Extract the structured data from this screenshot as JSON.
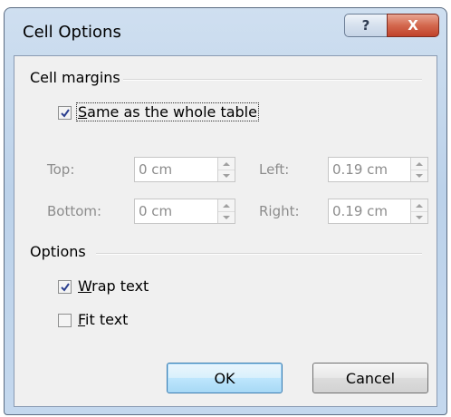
{
  "window": {
    "title": "Cell Options",
    "help_glyph": "?",
    "close_glyph": "X"
  },
  "cell_margins": {
    "group_label": "Cell margins",
    "same_as_table": {
      "label": "Same as the whole table",
      "mnemonic": "S",
      "rest": "ame as the whole table",
      "checked": true
    },
    "top": {
      "label": "Top:",
      "value": "0 cm"
    },
    "bottom": {
      "label": "Bottom:",
      "value": "0 cm"
    },
    "left": {
      "label": "Left:",
      "value": "0.19 cm"
    },
    "right": {
      "label": "Right:",
      "value": "0.19 cm"
    }
  },
  "options": {
    "group_label": "Options",
    "wrap_text": {
      "label": "Wrap text",
      "mnemonic": "W",
      "rest": "rap text",
      "checked": true
    },
    "fit_text": {
      "label": "Fit text",
      "mnemonic": "F",
      "rest": "it text",
      "checked": false
    }
  },
  "buttons": {
    "ok": "OK",
    "cancel": "Cancel"
  },
  "colors": {
    "check_mark": "#2b3f8f",
    "disabled_text": "#8c8c8c"
  }
}
